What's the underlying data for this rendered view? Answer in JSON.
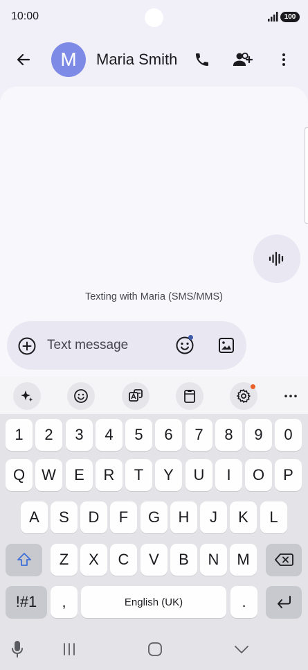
{
  "status_bar": {
    "time": "10:00",
    "battery": "100"
  },
  "header": {
    "avatar_letter": "M",
    "contact_name": "Maria Smith"
  },
  "conversation": {
    "info_text": "Texting with Maria (SMS/MMS)"
  },
  "compose": {
    "placeholder": "Text message"
  },
  "keyboard": {
    "row_numbers": [
      "1",
      "2",
      "3",
      "4",
      "5",
      "6",
      "7",
      "8",
      "9",
      "0"
    ],
    "row_q": [
      "Q",
      "W",
      "E",
      "R",
      "T",
      "Y",
      "U",
      "I",
      "O",
      "P"
    ],
    "row_a": [
      "A",
      "S",
      "D",
      "F",
      "G",
      "H",
      "J",
      "K",
      "L"
    ],
    "row_z": [
      "Z",
      "X",
      "C",
      "V",
      "B",
      "N",
      "M"
    ],
    "symbols_label": "!#1",
    "comma": ",",
    "space_label": "English (UK)",
    "period": "."
  },
  "colors": {
    "accent": "#7d8ae6",
    "notification_dot": "#e8622a",
    "emoji_dot": "#3f5aa9"
  },
  "icons": [
    "back-arrow-icon",
    "phone-icon",
    "add-person-icon",
    "more-vert-icon",
    "add-circle-icon",
    "emoji-icon",
    "image-icon",
    "voice-wave-icon",
    "sparkle-icon",
    "sticker-icon",
    "translate-icon",
    "clipboard-icon",
    "settings-icon",
    "more-horiz-icon",
    "shift-icon",
    "backspace-icon",
    "enter-icon",
    "mic-icon",
    "recents-icon",
    "home-icon",
    "back-chevron-icon"
  ]
}
